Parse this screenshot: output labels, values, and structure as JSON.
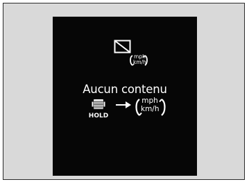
{
  "screen": {
    "message": "Aucun contenu",
    "unit_badge": {
      "top": "mph",
      "bottom": "km/h"
    },
    "hold_label": "HOLD",
    "unit_toggle": {
      "top": "mph",
      "bottom": "km/h"
    },
    "icons": [
      "no-content-icon",
      "thumbwheel-icon",
      "arrow-right-icon",
      "unit-cycle-arrows-icon"
    ],
    "colors": {
      "screen_bg": "#060606",
      "frame_bg": "#d9d9d9",
      "text": "#ffffff"
    }
  }
}
